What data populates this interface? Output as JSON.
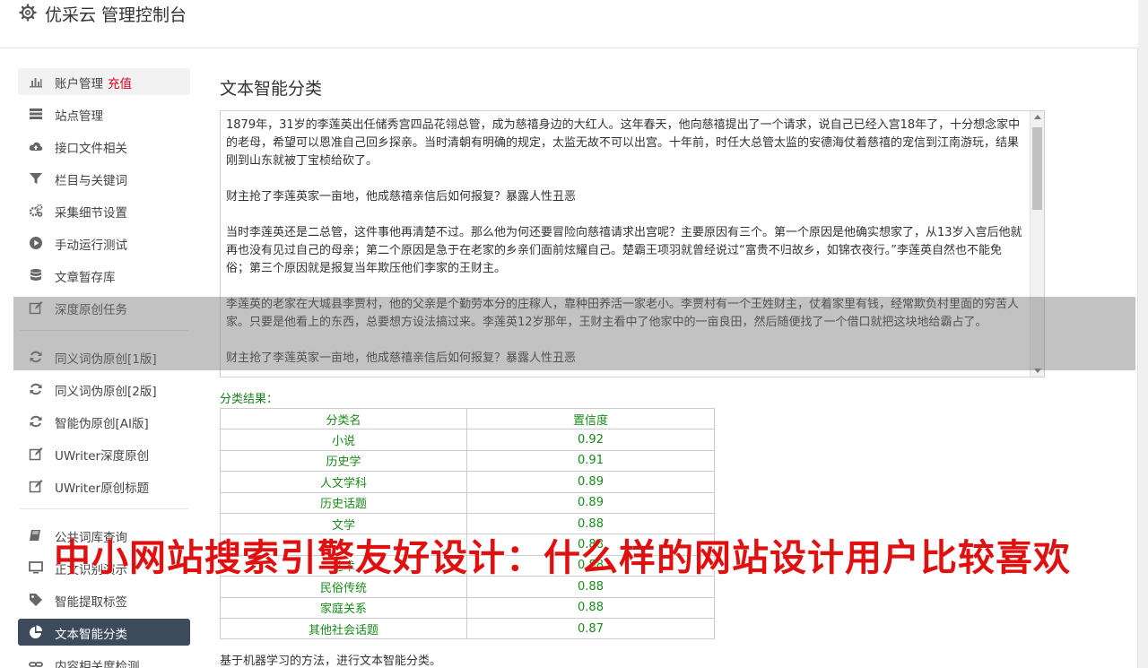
{
  "header": {
    "title": "优采云 管理控制台",
    "icon": "gear-icon"
  },
  "sidebar": {
    "items": [
      {
        "label": "账户管理",
        "extra": "充值",
        "icon": "bar-chart-icon"
      },
      {
        "label": "站点管理",
        "icon": "server-icon"
      },
      {
        "label": "接口文件相关",
        "icon": "cloud-upload-icon"
      },
      {
        "label": "栏目与关键词",
        "icon": "filter-icon"
      },
      {
        "label": "采集细节设置",
        "icon": "gears-icon"
      },
      {
        "label": "手动运行测试",
        "icon": "play-circle-icon"
      },
      {
        "label": "文章暂存库",
        "icon": "database-icon"
      },
      {
        "label": "深度原创任务",
        "icon": "edit-icon"
      },
      {
        "label": "同义词伪原创[1版]",
        "icon": "refresh-icon"
      },
      {
        "label": "同义词伪原创[2版]",
        "icon": "refresh-icon"
      },
      {
        "label": "智能伪原创[AI版]",
        "icon": "refresh-icon"
      },
      {
        "label": "UWriter深度原创",
        "icon": "edit-icon"
      },
      {
        "label": "UWriter原创标题",
        "icon": "edit-icon"
      },
      {
        "label": "公共词库查询",
        "icon": "book-icon"
      },
      {
        "label": "正文识别演示",
        "icon": "monitor-icon"
      },
      {
        "label": "智能提取标签",
        "icon": "tag-icon"
      },
      {
        "label": "文本智能分类",
        "icon": "pie-chart-icon"
      },
      {
        "label": "内容相关度检测",
        "icon": "link-icon"
      }
    ]
  },
  "main": {
    "title": "文本智能分类",
    "text_paragraphs": [
      "1879年，31岁的李莲英出任储秀宫四品花翎总管，成为慈禧身边的大红人。这年春天，他向慈禧提出了一个请求，说自己已经入宫18年了，十分想念家中的老母，希望可以恩准自己回乡探亲。当时清朝有明确的规定，太监无故不可以出宫。十年前，时任大总管太监的安德海仗着慈禧的宠信到江南游玩，结果刚到山东就被丁宝桢给砍了。",
      "财主抢了李莲英家一亩地，他成慈禧亲信后如何报复？暴露人性丑恶",
      "当时李莲英还是二总管，这件事他再清楚不过。那么他为何还要冒险向慈禧请求出宫呢？主要原因有三个。第一个原因是他确实想家了，从13岁入宫后他就再也没有见过自己的母亲；第二个原因是急于在老家的乡亲们面前炫耀自己。楚霸王项羽就曾经说过“富贵不归故乡，如锦衣夜行。”李莲英自然也不能免俗；第三个原因就是报复当年欺压他们李家的王财主。",
      "李莲英的老家在大城县李贾村，他的父亲是个勤劳本分的庄稼人，靠种田养活一家老小。李贾村有一个王姓财主，仗着家里有钱，经常欺负村里面的穷苦人家。只要是他看上的东西，总要想方设法搞过来。李莲英12岁那年，王财主看中了他家中的一亩良田，然后随便找了一个借口就把这块地给霸占了。",
      "财主抢了李莲英家一亩地，他成慈禧亲信后如何报复？暴露人性丑恶"
    ],
    "result_label": "分类结果：",
    "table": {
      "headers": [
        "分类名",
        "置信度"
      ],
      "rows": [
        [
          "小说",
          "0.92"
        ],
        [
          "历史学",
          "0.91"
        ],
        [
          "人文学科",
          "0.89"
        ],
        [
          "历史话题",
          "0.89"
        ],
        [
          "文学",
          "0.88"
        ],
        [
          "",
          "0.88"
        ],
        [
          "艺术",
          "0.88"
        ],
        [
          "民俗传统",
          "0.88"
        ],
        [
          "家庭关系",
          "0.88"
        ],
        [
          "其他社会话题",
          "0.87"
        ]
      ]
    },
    "footnote": "基于机器学习的方法，进行文本智能分类。"
  },
  "watermark": "中小网站搜索引擎友好设计：什么样的网站设计用户比较喜欢",
  "colors": {
    "active_nav_bg": "#3c4a5c",
    "accent_red": "#d9001b",
    "result_green": "#1a8a1a",
    "watermark_red": "#e01010"
  }
}
